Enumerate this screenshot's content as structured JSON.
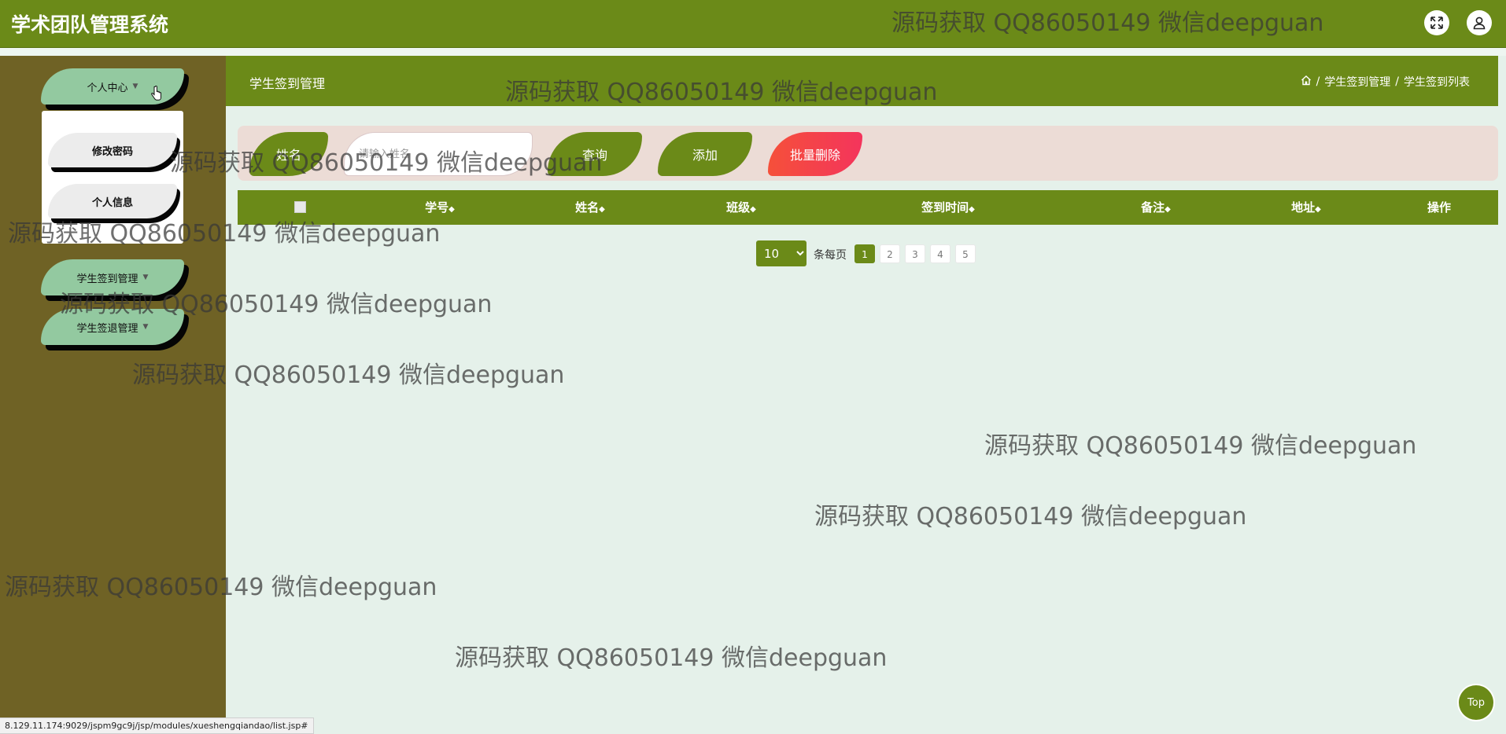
{
  "app": {
    "title": "学术团队管理系统"
  },
  "header": {
    "fullscreen_icon": "expand-icon",
    "user_icon": "user-icon"
  },
  "sidebar": {
    "items": [
      {
        "label": "个人中心",
        "expanded": true,
        "children": [
          {
            "label": "修改密码"
          },
          {
            "label": "个人信息"
          }
        ]
      },
      {
        "label": "学生签到管理"
      },
      {
        "label": "学生签退管理"
      }
    ]
  },
  "page": {
    "title": "学生签到管理",
    "breadcrumb": {
      "home_icon": "home-icon",
      "items": [
        "学生签到管理",
        "学生签到列表"
      ],
      "separator": "/"
    }
  },
  "search": {
    "label": "姓名",
    "placeholder": "请输入姓名",
    "query_label": "查询",
    "add_label": "添加",
    "batch_delete_label": "批量删除"
  },
  "table": {
    "columns": [
      "学号",
      "姓名",
      "班级",
      "签到时间",
      "备注",
      "地址",
      "操作"
    ],
    "sort_icon": "sort-icon",
    "rows": []
  },
  "pagination": {
    "page_size": "10",
    "page_size_options": [
      "10"
    ],
    "per_page_label": "条每页",
    "pages": [
      "1",
      "2",
      "3",
      "4",
      "5"
    ],
    "current": "1"
  },
  "watermark": "源码获取 QQ86050149 微信deepguan",
  "status_url": "8.129.11.174:9029/jspm9gc9j/jsp/modules/xueshengqiandao/list.jsp#",
  "back_to_top": "Top",
  "colors": {
    "primary": "#6b8a18",
    "sidebar": "#6f6225",
    "menu": "#93c9a0",
    "danger": "#f53d55",
    "background": "#e5f1ea"
  }
}
